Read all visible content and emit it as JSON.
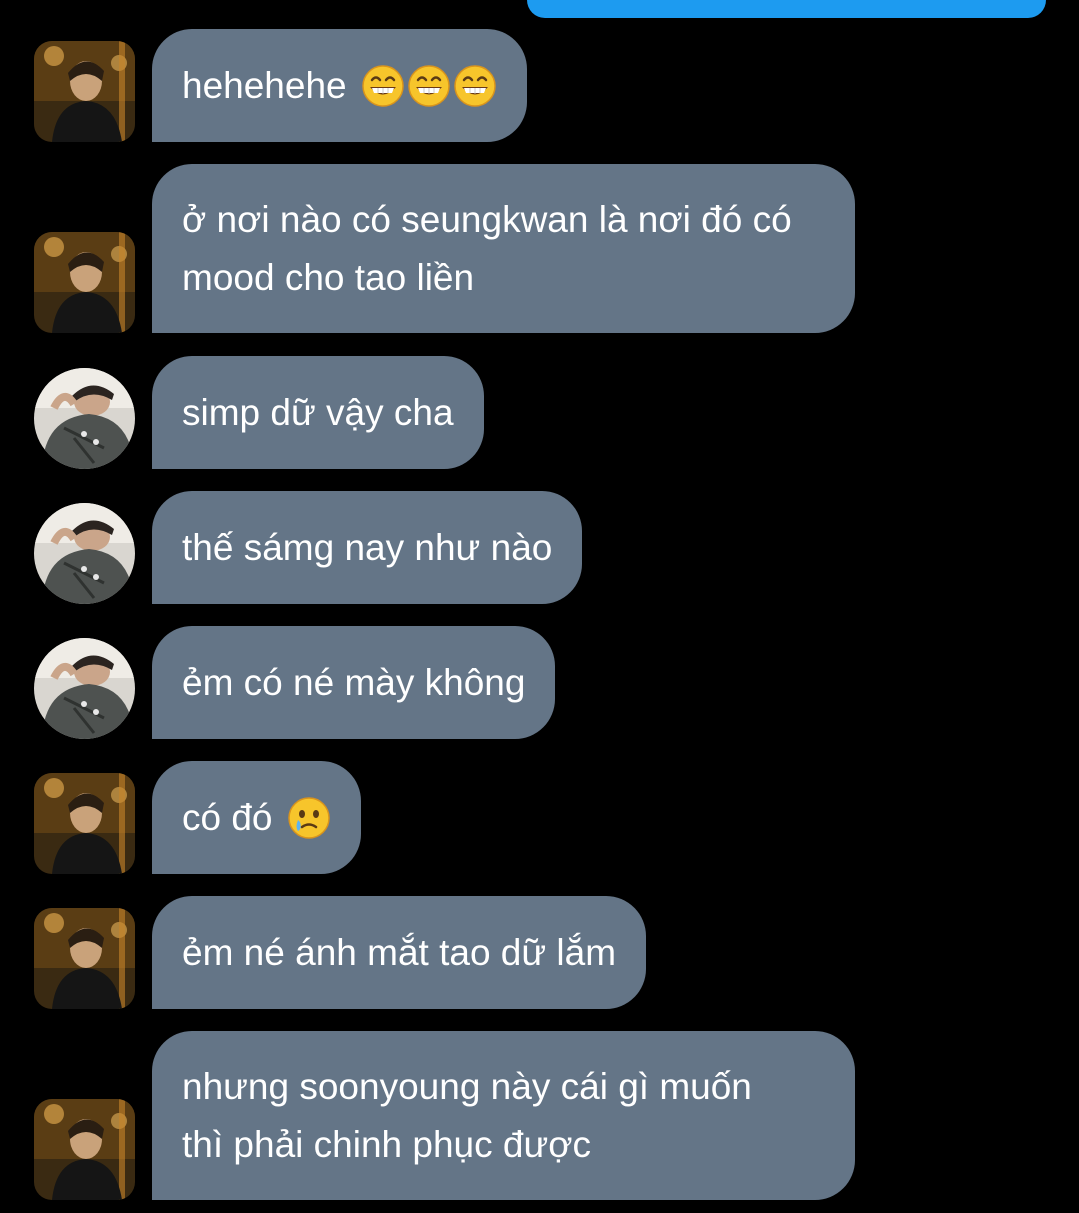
{
  "colors": {
    "background": "#000000",
    "received_bubble": "#647587",
    "sent_bubble": "#1d9bf0",
    "text": "#ffffff"
  },
  "sent_partial": {
    "icon": "sent-message-bubble-partial"
  },
  "messages": [
    {
      "sender": "user-a",
      "text": "hehehehe",
      "emoji": [
        "grinning-face-with-smiling-eyes",
        "grinning-face-with-smiling-eyes",
        "grinning-face-with-smiling-eyes"
      ]
    },
    {
      "sender": "user-a",
      "lines": [
        "ở nơi nào có seungkwan là nơi đó có",
        "mood cho tao liền"
      ]
    },
    {
      "sender": "user-b",
      "text": "simp dữ vậy cha"
    },
    {
      "sender": "user-b",
      "text": "thế sámg nay như nào"
    },
    {
      "sender": "user-b",
      "text": "ẻm có né mày không"
    },
    {
      "sender": "user-a",
      "text": "có đó",
      "emoji": [
        "face-holding-back-tears"
      ]
    },
    {
      "sender": "user-a",
      "text": "ẻm né ánh mắt tao dữ lắm"
    },
    {
      "sender": "user-a",
      "lines": [
        "nhưng soonyoung này cái gì muốn",
        "thì phải chinh phục được"
      ]
    }
  ]
}
